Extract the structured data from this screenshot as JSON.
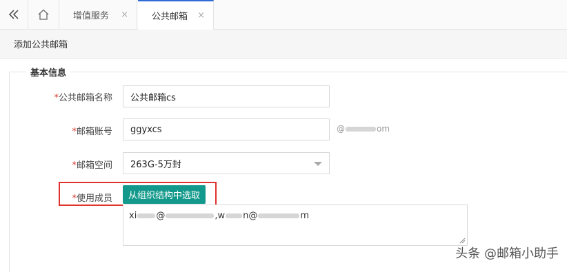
{
  "tabs": {
    "collapse_icon": "double-chevron-left-icon",
    "home_icon": "home-icon",
    "items": [
      {
        "label": "增值服务",
        "close": "×"
      },
      {
        "label": "公共邮箱",
        "close": "×"
      }
    ]
  },
  "page": {
    "title": "添加公共邮箱"
  },
  "form": {
    "section_title": "基本信息",
    "required_mark": "*",
    "fields": {
      "name": {
        "label": "公共邮箱名称",
        "value": "公共邮箱cs"
      },
      "account": {
        "label": "邮箱账号",
        "value": "ggyxcs",
        "domain_prefix": "@",
        "domain_suffix": "om"
      },
      "space": {
        "label": "邮箱空间",
        "value": "263G-5万封"
      },
      "members": {
        "label": "使用成员",
        "button": "从组织结构中选取",
        "value_parts": [
          "xi",
          "@",
          ",w",
          "n@",
          "m"
        ]
      }
    }
  },
  "watermark": "头条 @邮箱小助手",
  "colors": {
    "accent": "#13998b",
    "required": "#d93a2e",
    "highlight": "#e0312f",
    "active_tab": "#2f6bd6"
  }
}
